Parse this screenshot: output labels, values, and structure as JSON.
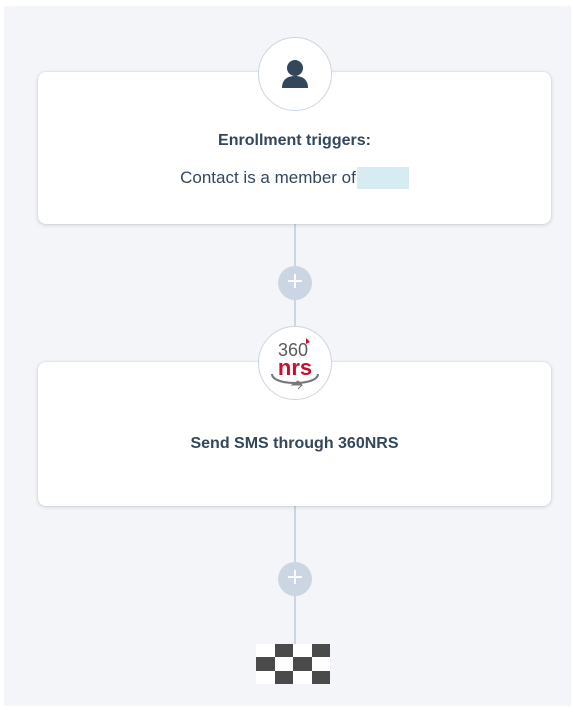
{
  "workflow": {
    "trigger": {
      "icon": "user-icon",
      "title": "Enrollment triggers:",
      "description": "Contact is a member of"
    },
    "add_action_1": {
      "label": "+"
    },
    "action": {
      "logo": {
        "name": "360nrs-logo",
        "text_top": "360",
        "text_bottom": "nrs",
        "accent_color": "#c8102e"
      },
      "title": "Send SMS through 360NRS"
    },
    "add_action_2": {
      "label": "+"
    },
    "end": {
      "icon": "checkered-flag-icon"
    }
  },
  "colors": {
    "canvas": "#f3f5f8",
    "connector": "#cbd6e2",
    "text": "#33475b",
    "brand_red": "#c8102e"
  }
}
